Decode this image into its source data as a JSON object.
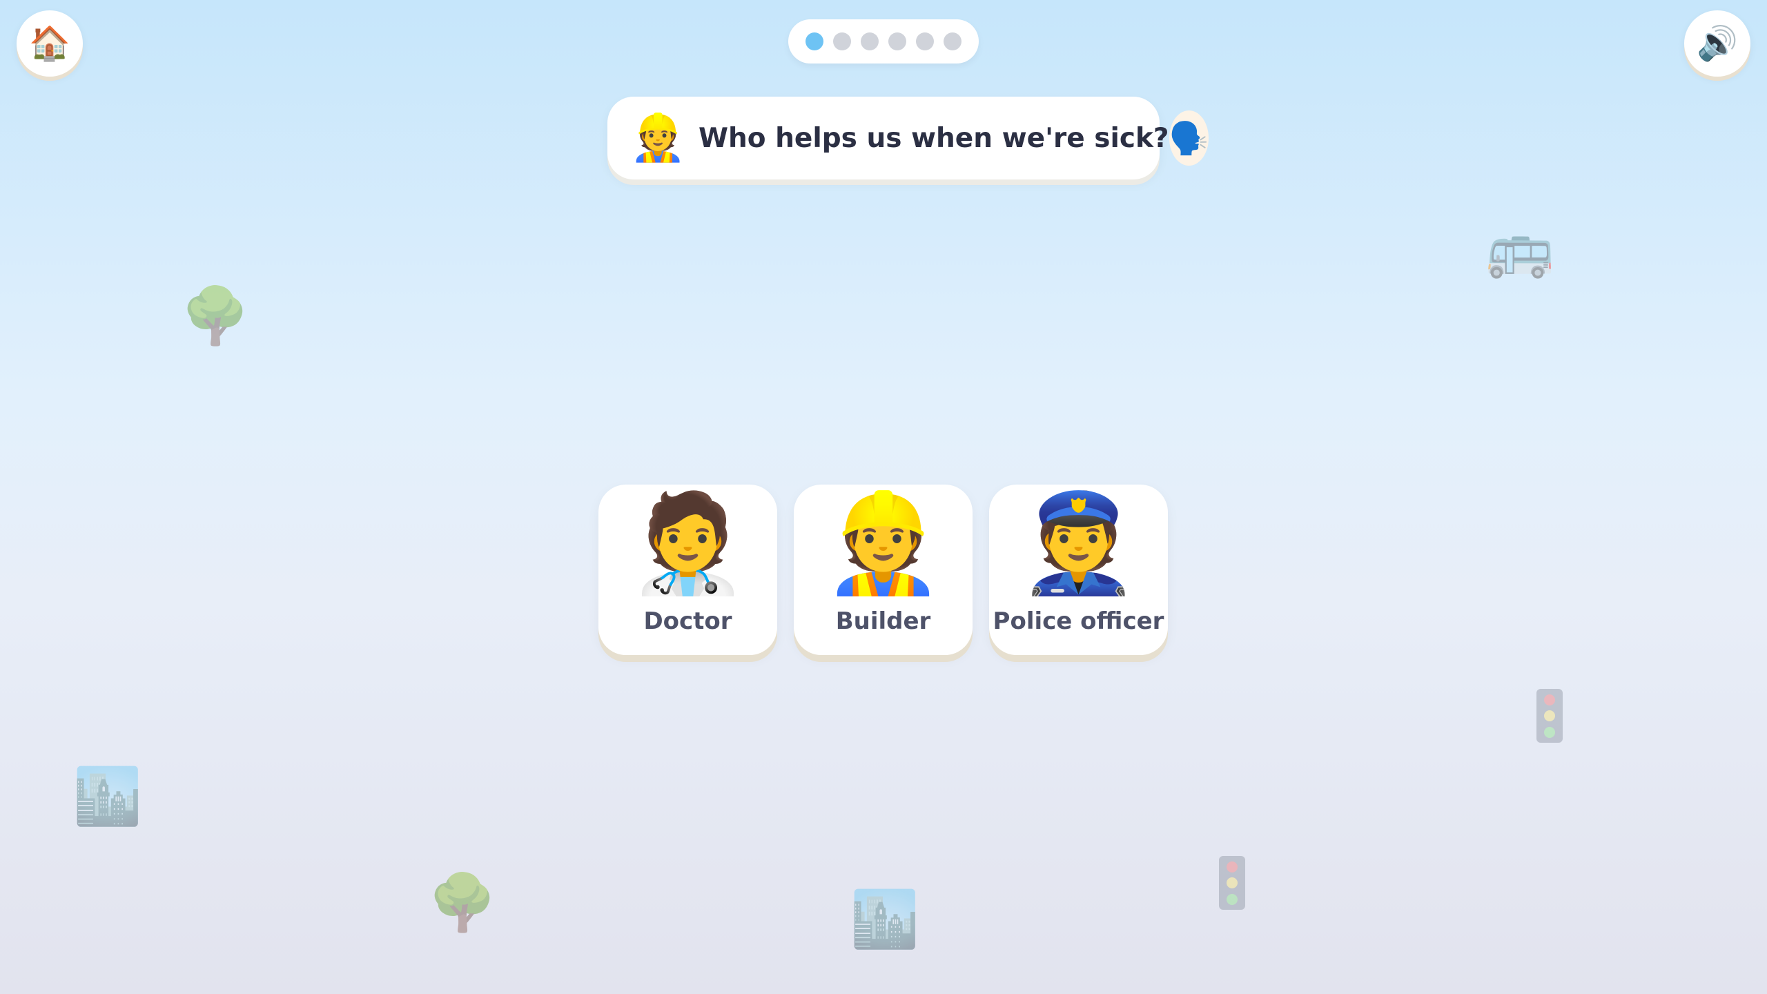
{
  "header": {
    "home_icon": "🏠",
    "sound_icon": "🔊",
    "progress": {
      "total": 6,
      "current": 1
    }
  },
  "question": {
    "avatar_icon": "👷",
    "text": "Who helps us when we're sick?",
    "speak_icon": "🗣️"
  },
  "answers": [
    {
      "icon": "🧑‍⚕️",
      "label": "Doctor"
    },
    {
      "icon": "👷",
      "label": "Builder"
    },
    {
      "icon": "👮",
      "label": "Police officer"
    }
  ],
  "decorations": {
    "tree_icon": "🌳",
    "bus_icon": "🚌",
    "city_icon": "🏙️",
    "traffic_light": "traffic-light-icon"
  },
  "colors": {
    "progress_active": "#6ec3f4",
    "progress_inactive": "#d0d3da",
    "question_text": "#2b2f43",
    "card_label": "#4e5269"
  }
}
